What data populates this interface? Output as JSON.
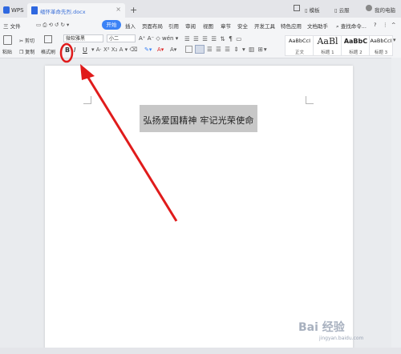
{
  "titlebar": {
    "app_tab": "WPS",
    "doc_tab": "缅怀革命先烈.docx",
    "right_items": [
      "模板",
      "云服",
      "我的电脑"
    ]
  },
  "menu": {
    "file": "三 文件",
    "start": "开始",
    "items": [
      "插入",
      "页面布局",
      "引用",
      "审阅",
      "视图",
      "章节",
      "安全",
      "开发工具",
      "特色应用",
      "文档助手"
    ],
    "search": "查找命令..."
  },
  "ribbon": {
    "cut": "剪切",
    "copy": "复制",
    "paste": "粘贴",
    "format_painter": "格式刷",
    "font_name": "微软雅黑",
    "font_size": "小二",
    "bold": "B",
    "italic": "I",
    "underline": "U",
    "styles": [
      {
        "sample": "AaBbCcI",
        "name": "正文"
      },
      {
        "sample": "AaBl",
        "name": "标题 1"
      },
      {
        "sample": "AaBbC",
        "name": "标题 2"
      },
      {
        "sample": "AaBbCcI",
        "name": "标题 3"
      }
    ]
  },
  "document": {
    "text": "弘扬爱国精神  牢记光荣使命"
  },
  "watermark": {
    "brand": "Bai 经验",
    "url": "jingyan.baidu.com"
  },
  "colors": {
    "accent": "#3b82f6",
    "annotation": "#e01b1b",
    "selection": "#c7c7c7"
  }
}
